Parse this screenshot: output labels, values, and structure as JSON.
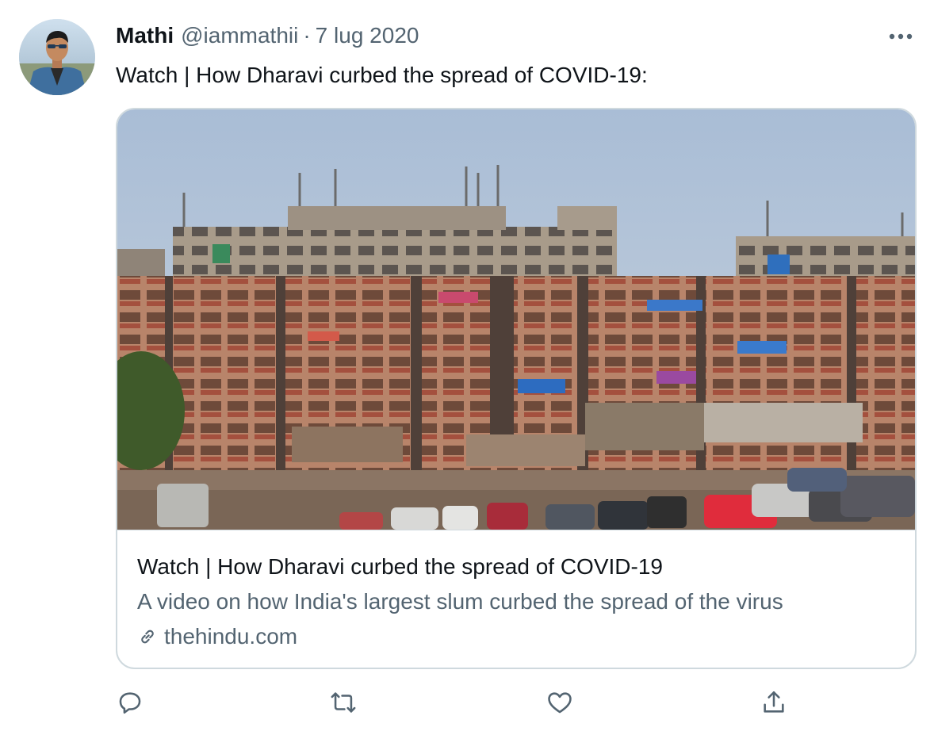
{
  "tweet": {
    "author_name": "Mathi",
    "author_handle": "@iammathii",
    "separator": "·",
    "date": "7 lug 2020",
    "text": "Watch | How Dharavi curbed the spread of COVID-19:"
  },
  "card": {
    "title": "Watch | How Dharavi curbed the spread of COVID-19",
    "description": "A video on how India's largest slum curbed the spread of the virus",
    "domain": "thehindu.com"
  },
  "icons": {
    "more": "more-horizontal-icon",
    "link": "link-icon",
    "reply": "reply-icon",
    "retweet": "retweet-icon",
    "like": "heart-icon",
    "share": "share-icon"
  },
  "colors": {
    "text_primary": "#0f1419",
    "text_secondary": "#536471",
    "border": "#cfd9de"
  }
}
